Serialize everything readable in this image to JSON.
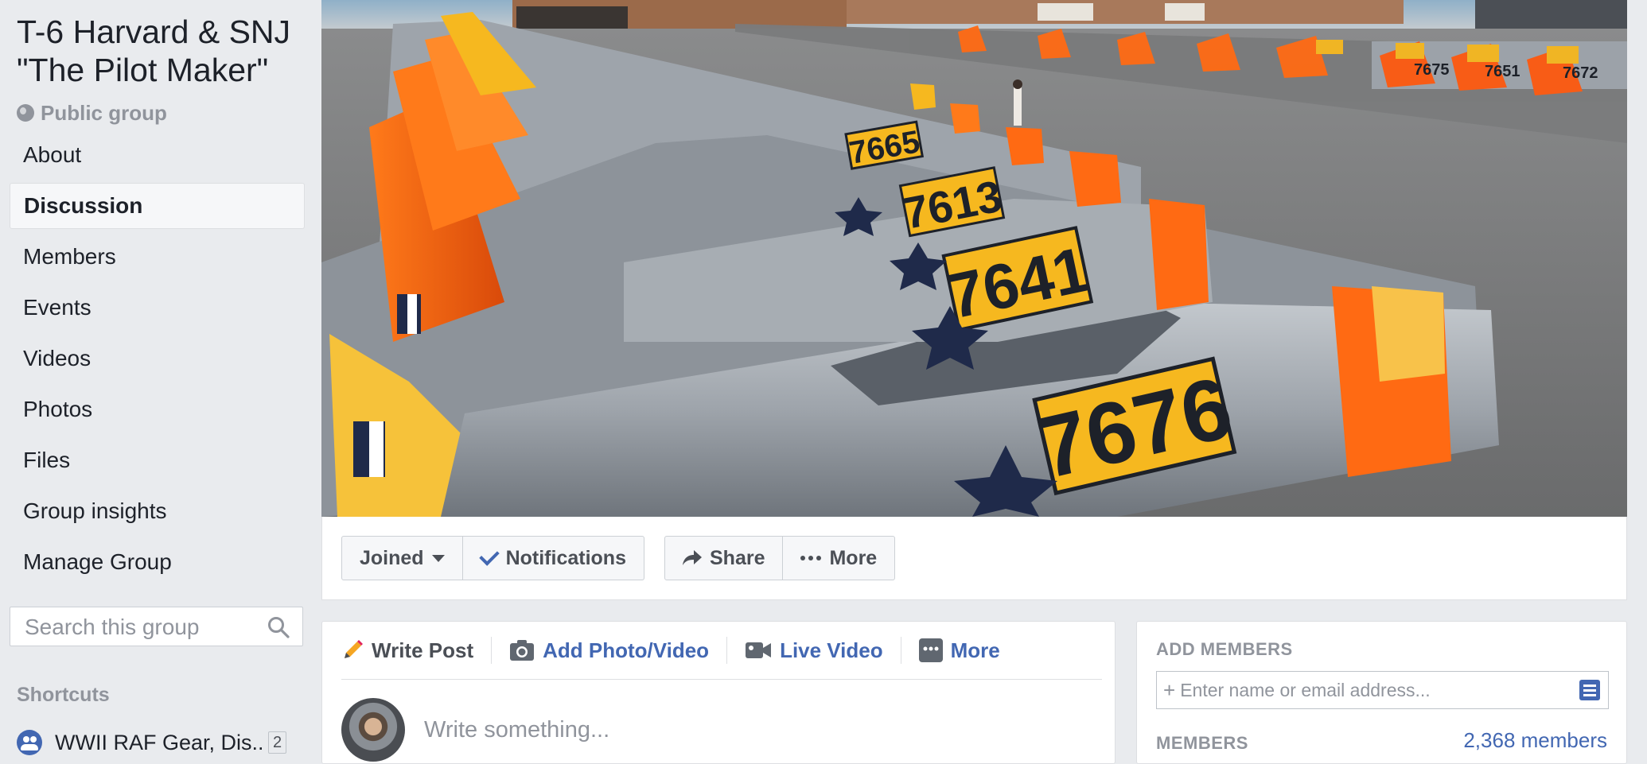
{
  "group": {
    "title": "T-6 Harvard & SNJ \"The Pilot Maker\"",
    "privacy": "Public group"
  },
  "nav": {
    "items": [
      {
        "label": "About"
      },
      {
        "label": "Discussion",
        "active": true
      },
      {
        "label": "Members"
      },
      {
        "label": "Events"
      },
      {
        "label": "Videos"
      },
      {
        "label": "Photos"
      },
      {
        "label": "Files"
      },
      {
        "label": "Group insights"
      },
      {
        "label": "Manage Group"
      }
    ]
  },
  "search": {
    "placeholder": "Search this group"
  },
  "shortcuts": {
    "heading": "Shortcuts",
    "items": [
      {
        "label": "WWII RAF Gear, Dis...",
        "badge": "2"
      }
    ]
  },
  "cover": {
    "aircraft_numbers": [
      "7676",
      "7641",
      "7613",
      "7665",
      "7675",
      "7651",
      "7672"
    ]
  },
  "actions": {
    "joined": "Joined",
    "notifications": "Notifications",
    "share": "Share",
    "more": "More"
  },
  "composer": {
    "tabs": {
      "write_post": "Write Post",
      "add_photo_video": "Add Photo/Video",
      "live_video": "Live Video",
      "more": "More"
    },
    "placeholder": "Write something..."
  },
  "add_members": {
    "title": "ADD MEMBERS",
    "input_placeholder": "Enter name or email address...",
    "members_heading": "MEMBERS",
    "members_count": "2,368 members"
  },
  "colors": {
    "page_bg": "#e9ebee",
    "brand_blue": "#4267b2",
    "muted_text": "#90949c",
    "aircraft_orange": "#ff6a13",
    "aircraft_yellow": "#f6b81f",
    "aircraft_silver": "#9ea4ab"
  }
}
